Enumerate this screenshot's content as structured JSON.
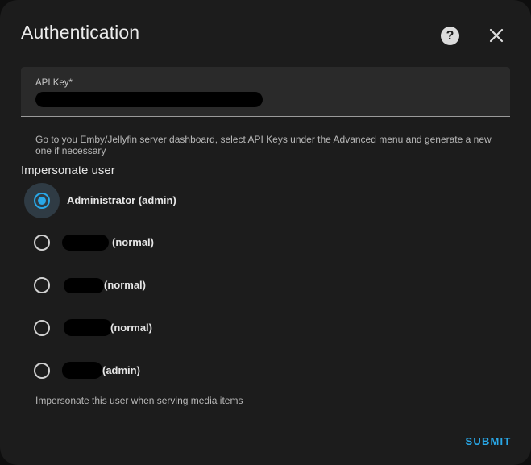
{
  "dialog": {
    "title": "Authentication"
  },
  "api_key": {
    "label": "API Key*",
    "value": ""
  },
  "helper_text": "Go to you Emby/Jellyfin server dashboard, select API Keys under the Advanced menu and generate a new one if necessary",
  "impersonate": {
    "label": "Impersonate user",
    "options": [
      {
        "label": "Administrator (admin)",
        "checked": true
      },
      {
        "label": "(normal)",
        "checked": false
      },
      {
        "label": "(normal)",
        "checked": false
      },
      {
        "label": "(normal)",
        "checked": false
      },
      {
        "label": "(admin)",
        "checked": false
      }
    ],
    "hint": "Impersonate this user when serving media items"
  },
  "actions": {
    "submit_label": "SUBMIT"
  },
  "colors": {
    "accent": "#29a8e8",
    "dialog_bg": "#1c1c1c",
    "field_bg": "#2a2a2a"
  },
  "icons": {
    "help": "help-circle-icon",
    "close": "close-icon"
  }
}
